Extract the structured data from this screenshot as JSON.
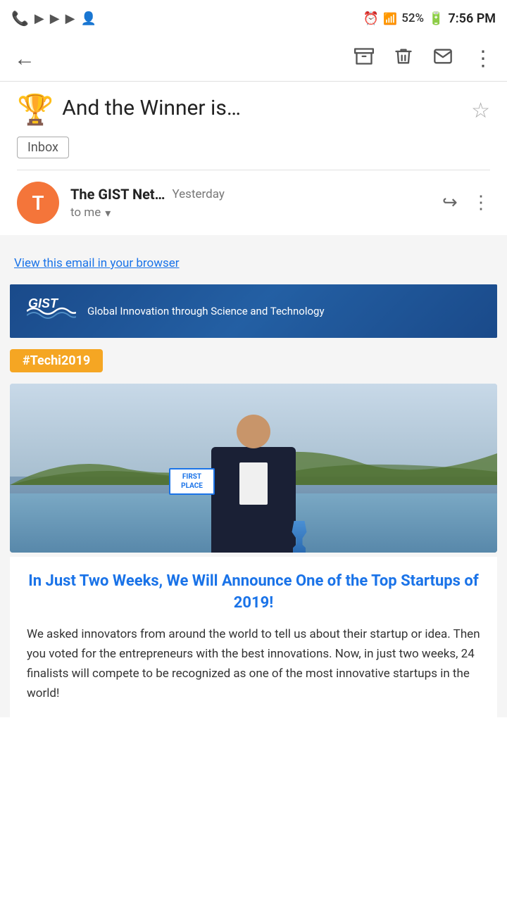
{
  "status_bar": {
    "time": "7:56 PM",
    "battery": "52%",
    "icons_left": [
      "viber-icon",
      "youtube-icon",
      "youtube-icon",
      "youtube-icon",
      "contacts-icon"
    ],
    "icons_right": [
      "alarm-icon",
      "signal-icon",
      "battery-icon"
    ]
  },
  "toolbar": {
    "back_label": "←",
    "archive_label": "⬇",
    "delete_label": "🗑",
    "email_label": "✉",
    "more_label": "⋮"
  },
  "subject": {
    "emoji": "🏆",
    "title": "And the Winner is…",
    "star_label": "☆"
  },
  "inbox_badge": {
    "label": "Inbox"
  },
  "sender": {
    "avatar_letter": "T",
    "name": "The GIST Net…",
    "time": "Yesterday",
    "to_label": "to me",
    "reply_label": "↩",
    "more_label": "⋮"
  },
  "email": {
    "view_browser_link": "View this email in your browser",
    "gist_logo": "GIST",
    "gist_tagline": "Global Innovation through Science and Technology",
    "hashtag": "#Techi2019",
    "first_place_text": "FIRST PLACE",
    "headline": "In Just Two Weeks, We Will Announce One of the Top Startups of 2019!",
    "body": "We asked innovators from around the world to tell us about their startup or idea. Then you voted for the entrepreneurs with the best innovations. Now, in just two weeks, 24 finalists will compete to be recognized as one of the most innovative startups in the world!"
  }
}
